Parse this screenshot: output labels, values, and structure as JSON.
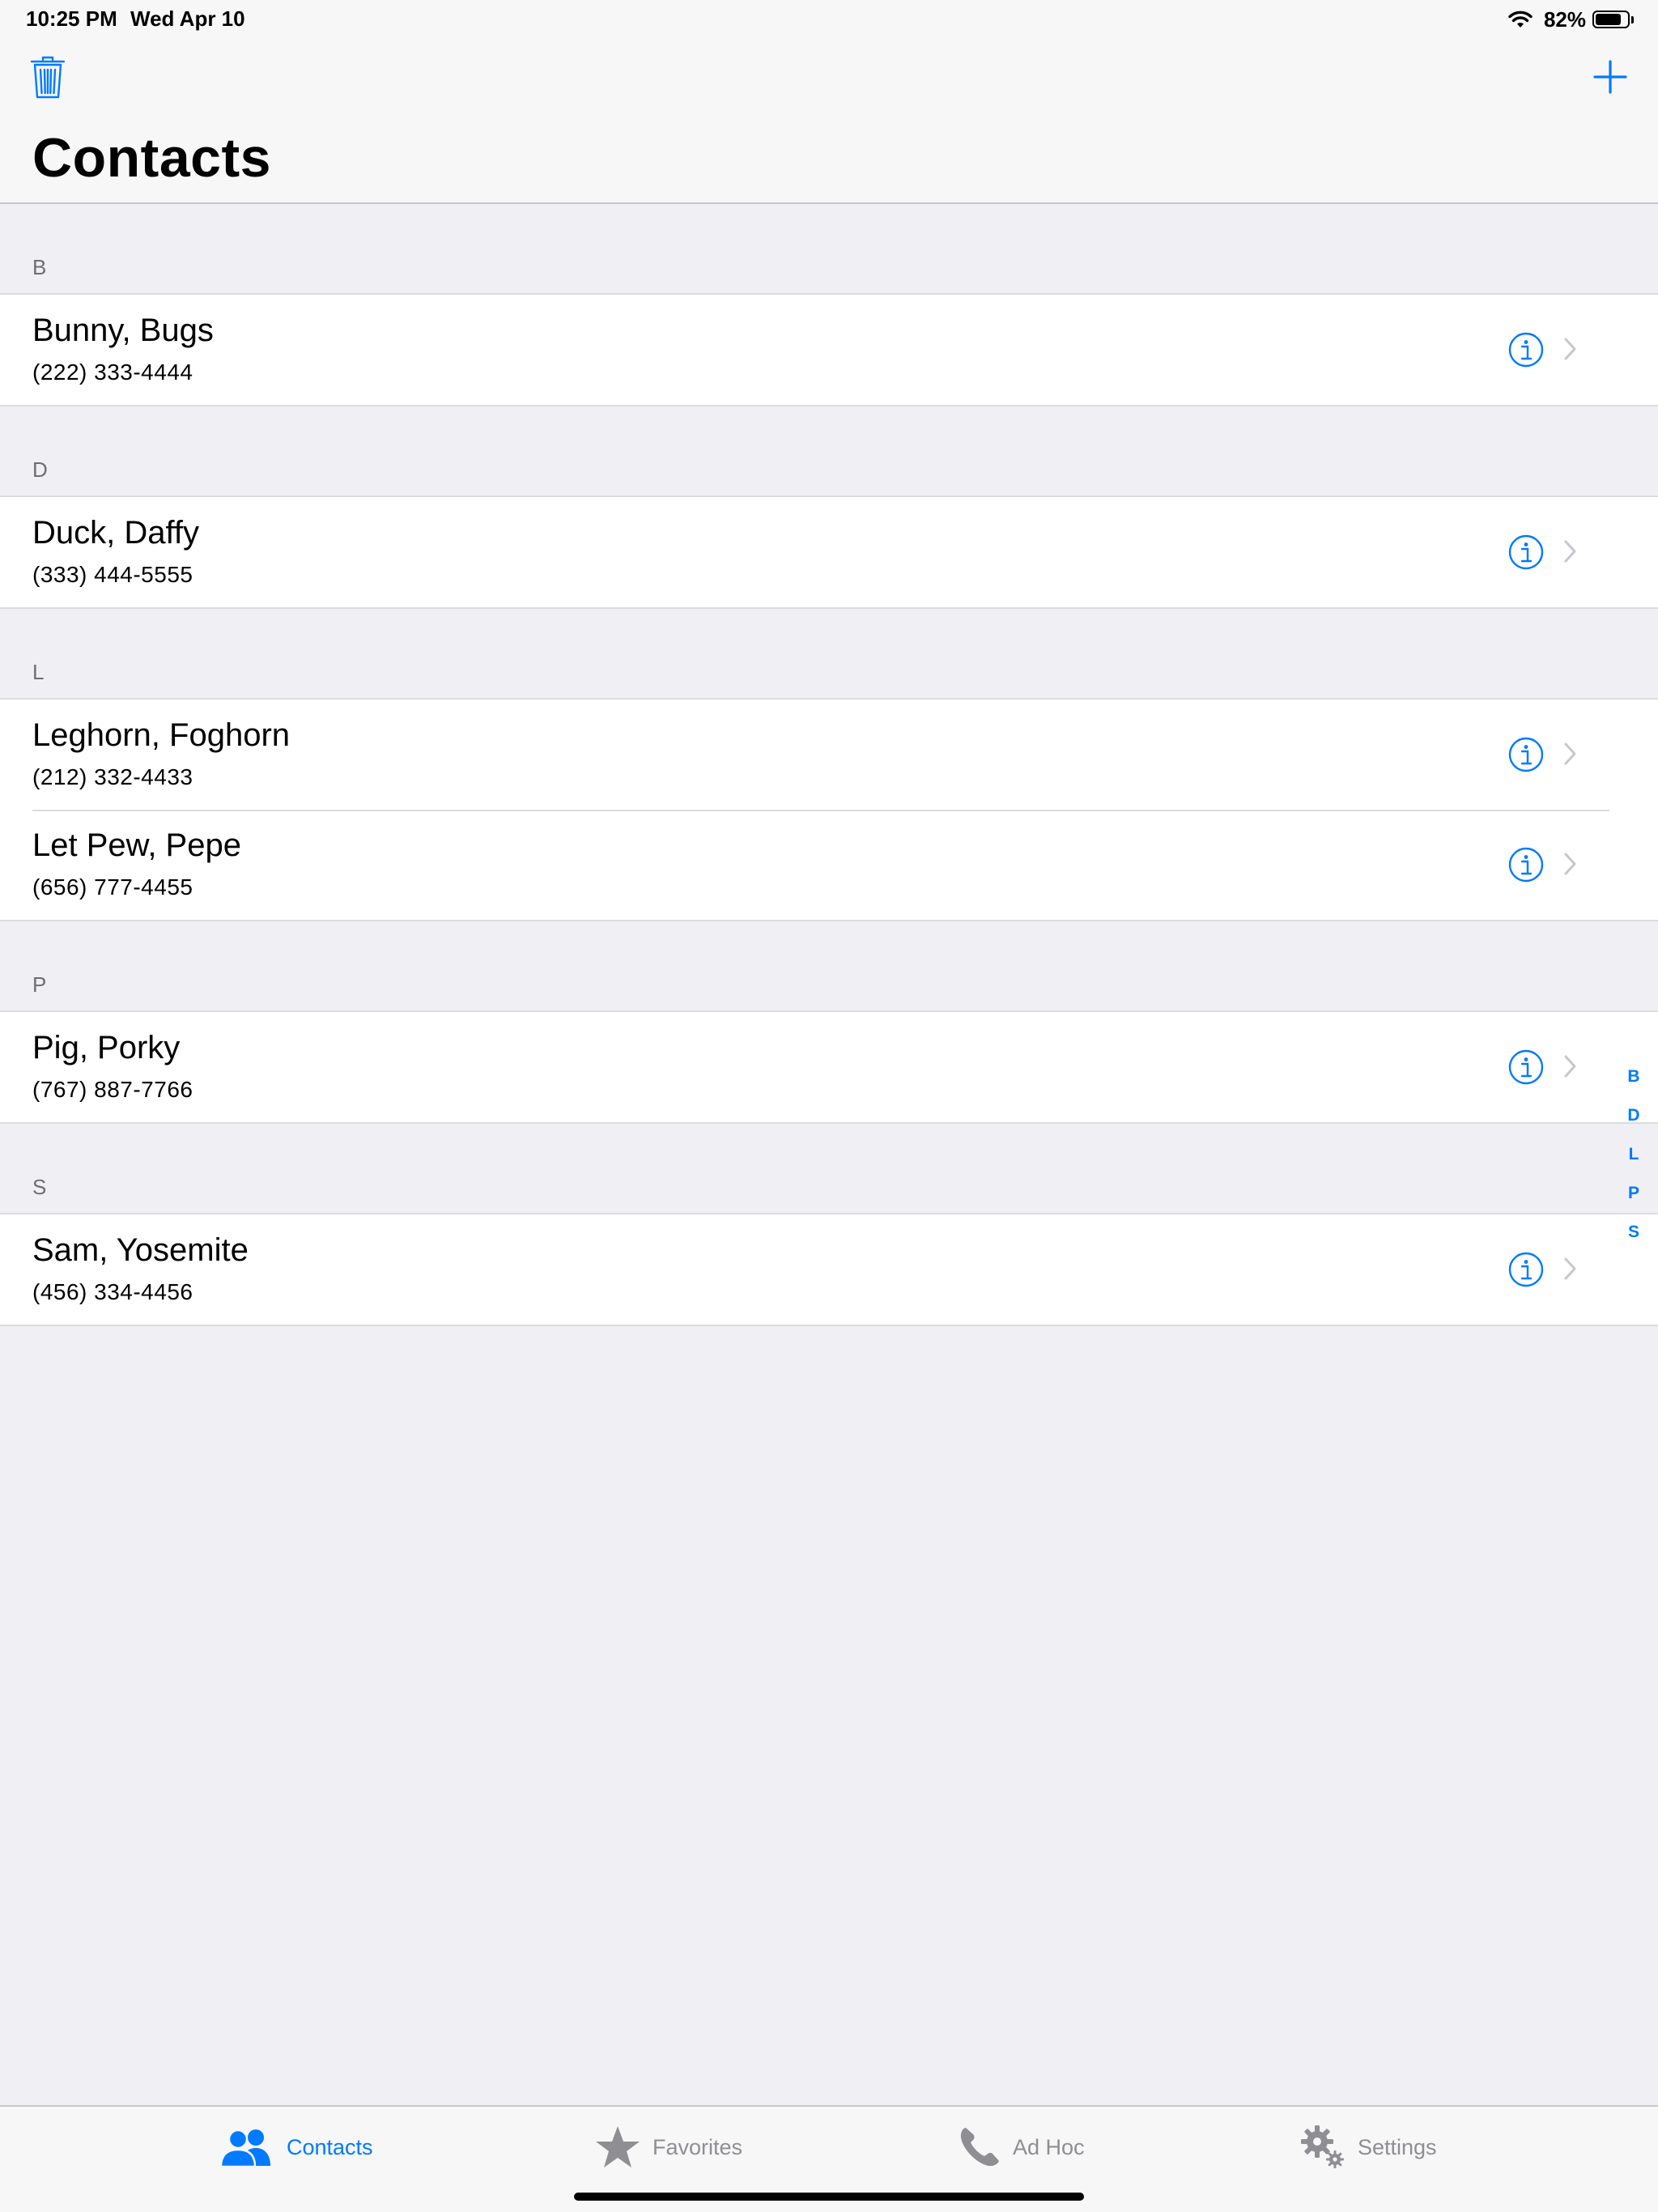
{
  "status_bar": {
    "time": "10:25 PM",
    "date": "Wed Apr 10",
    "battery": "82%",
    "battery_level": 0.82
  },
  "nav": {
    "title": "Contacts",
    "left_icon": "trash-icon",
    "right_icon": "plus-icon"
  },
  "sections": [
    {
      "letter": "B",
      "contacts": [
        {
          "name": "Bunny, Bugs",
          "phone": "(222) 333-4444"
        }
      ]
    },
    {
      "letter": "D",
      "contacts": [
        {
          "name": "Duck, Daffy",
          "phone": "(333) 444-5555"
        }
      ]
    },
    {
      "letter": "L",
      "contacts": [
        {
          "name": "Leghorn, Foghorn",
          "phone": "(212) 332-4433"
        },
        {
          "name": "Let Pew, Pepe",
          "phone": "(656) 777-4455"
        }
      ]
    },
    {
      "letter": "P",
      "contacts": [
        {
          "name": "Pig, Porky",
          "phone": "(767) 887-7766"
        }
      ]
    },
    {
      "letter": "S",
      "contacts": [
        {
          "name": "Sam, Yosemite",
          "phone": "(456) 334-4456"
        }
      ]
    }
  ],
  "index": [
    "B",
    "D",
    "L",
    "P",
    "S"
  ],
  "tabs": [
    {
      "label": "Contacts",
      "icon": "contacts-icon",
      "active": true
    },
    {
      "label": "Favorites",
      "icon": "star-icon",
      "active": false
    },
    {
      "label": "Ad Hoc",
      "icon": "phone-icon",
      "active": false
    },
    {
      "label": "Settings",
      "icon": "gear-icon",
      "active": false
    }
  ],
  "colors": {
    "accent": "#007aff",
    "inactive": "#8e8e93",
    "background": "#efeff4"
  }
}
